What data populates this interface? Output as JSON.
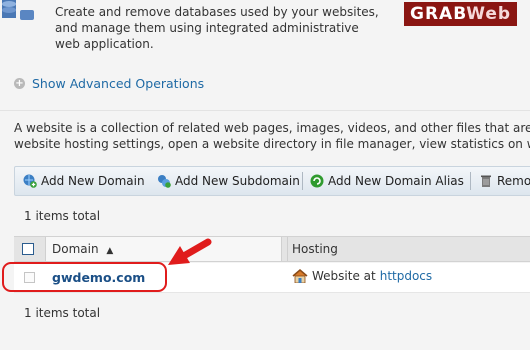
{
  "header": {
    "description_line1": "Create and remove databases used by your websites,",
    "description_line2": "and manage them using integrated administrative",
    "description_line3": "web application.",
    "watermark_part1": "GRAB",
    "watermark_part2": "Web"
  },
  "advanced": {
    "label": "Show Advanced Operations",
    "icon": "plus-circle-icon"
  },
  "info": {
    "line1": "A website is a collection of related web pages, images, videos, and other files that are a",
    "line2": "website hosting settings, open a website directory in file manager, view statistics on we"
  },
  "toolbar": {
    "add_domain": "Add New Domain",
    "add_subdomain": "Add New Subdomain",
    "add_alias": "Add New Domain Alias",
    "remove": "Remo"
  },
  "table": {
    "total_top": "1 items total",
    "total_bottom": "1 items total",
    "col_domain": "Domain",
    "col_hosting": "Hosting",
    "sort_indicator": "▲",
    "rows": [
      {
        "domain": "gwdemo.com",
        "hosting_prefix": "Website at",
        "hosting_link": "httpdocs"
      }
    ]
  },
  "colors": {
    "link": "#1f6aa5",
    "highlight": "#e01c1c",
    "toolbar_bg": "#dde6ee"
  }
}
